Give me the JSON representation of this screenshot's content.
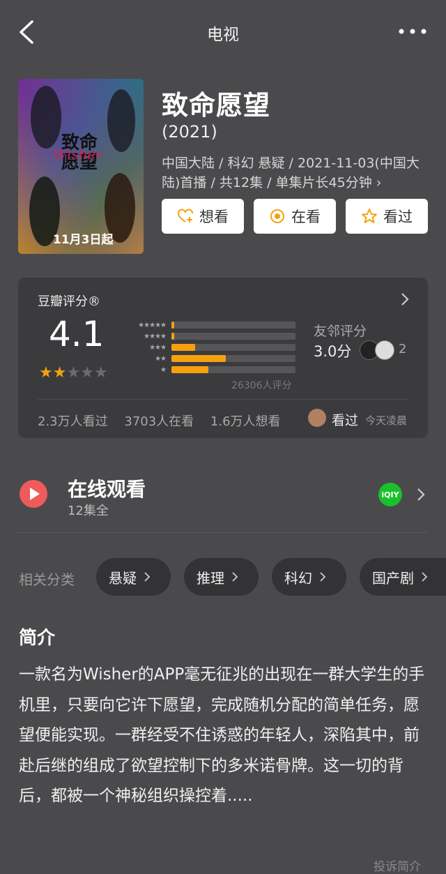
{
  "header": {
    "title": "电视"
  },
  "movie": {
    "name": "致命愿望",
    "year": "(2021)",
    "meta": "中国大陆 / 科幻 悬疑 / 2021-11-03(中国大陆)首播 / 共12集 / 单集片长45分钟 ›",
    "poster": {
      "title_text": "致命愿望",
      "wisher": "Wisher",
      "date": "11月3日起"
    }
  },
  "actions": {
    "want": "想看",
    "watching": "在看",
    "watched": "看过"
  },
  "rating": {
    "label": "豆瓣评分®",
    "score": "4.1",
    "stars_filled": 2,
    "stars_total": 5,
    "distribution": [
      0.02,
      0.02,
      0.19,
      0.44,
      0.3
    ],
    "count": "26306人评分",
    "neighbor_label": "友邻评分",
    "neighbor_score": "3.0分",
    "neighbor_count": "2",
    "stats": [
      "2.3万人看过",
      "3703人在看",
      "1.6万人想看"
    ],
    "my_status": "看过",
    "my_time": "今天凌晨"
  },
  "watch": {
    "title": "在线观看",
    "sub": "12集全",
    "platform": "iQIY"
  },
  "categories": {
    "label": "相关分类",
    "tags": [
      "悬疑",
      "推理",
      "科幻",
      "国产剧"
    ]
  },
  "intro": {
    "title": "简介",
    "text": "一款名为Wisher的APP毫无征兆的出现在一群大学生的手机里，只要向它许下愿望，完成随机分配的简单任务，愿望便能实现。一群经受不住诱惑的年轻人，深陷其中，前赴后继的组成了欲望控制下的多米诺骨牌。这一切的背后，都被一个神秘组织操控着.....",
    "report": "投诉简介"
  },
  "colors": {
    "accent": "#f5a10f",
    "play": "#ef5a5a",
    "iqiyi": "#19c02a"
  }
}
